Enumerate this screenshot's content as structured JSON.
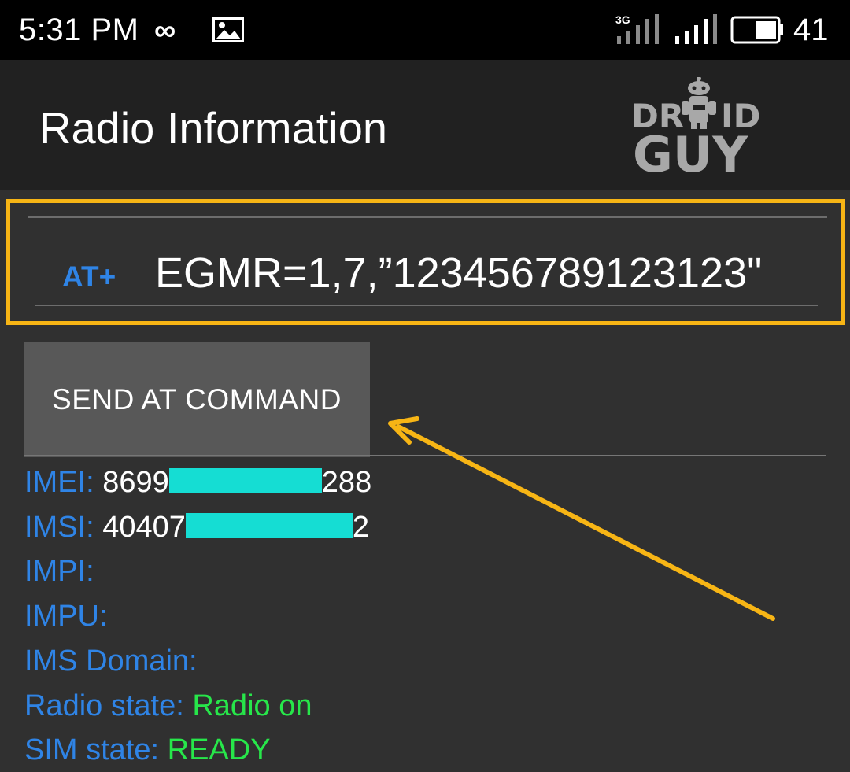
{
  "status_bar": {
    "time": "5:31 PM",
    "infinity_glyph": "∞",
    "network_type": "3G",
    "battery_level": "41",
    "icons": [
      "infinity-icon",
      "image-icon",
      "signal-3g-icon",
      "signal-icon",
      "battery-icon"
    ]
  },
  "header": {
    "title": "Radio Information",
    "watermark_top": "DR",
    "watermark_top_end": "ID",
    "watermark_bottom": "GUY"
  },
  "at_command": {
    "prefix": "AT+",
    "value": "EGMR=1,7,”123456789123123\""
  },
  "send_button": {
    "label": "SEND AT COMMAND"
  },
  "info": {
    "imei": {
      "label": "IMEI:",
      "value_start": "8699",
      "value_end": "288"
    },
    "imsi": {
      "label": "IMSI:",
      "value_start": "40407",
      "value_end": "2"
    },
    "impi": {
      "label": "IMPI:"
    },
    "impu": {
      "label": "IMPU:"
    },
    "ims_domain": {
      "label": "IMS Domain:"
    },
    "radio_state": {
      "label": "Radio state:",
      "value": "Radio on"
    },
    "sim_state": {
      "label": "SIM state:",
      "value": "READY"
    }
  },
  "colors": {
    "highlight_box": "#f7b515",
    "arrow": "#f7b515",
    "label_blue": "#2f84e6",
    "state_green": "#27e64a",
    "redaction": "#15ddd3"
  }
}
